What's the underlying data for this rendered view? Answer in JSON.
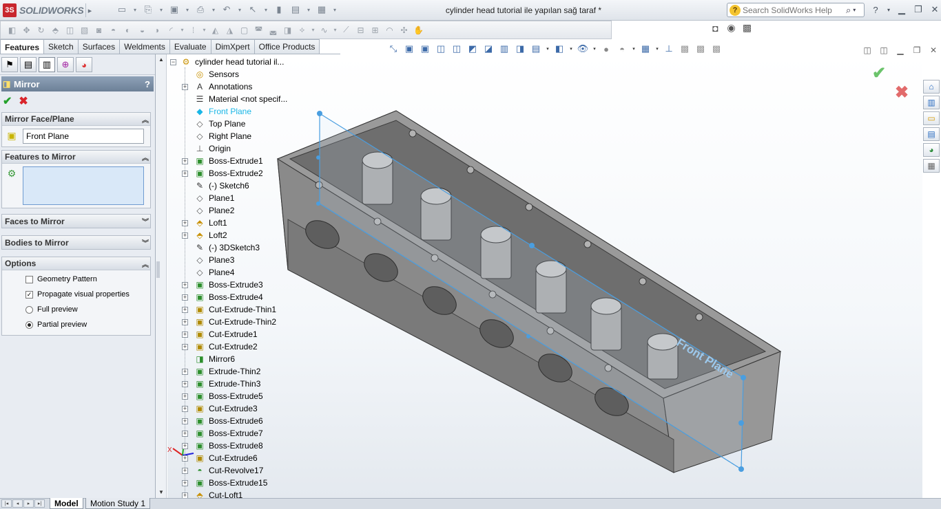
{
  "app": {
    "logo_text": "SOLIDWORKS",
    "document_title": "cylinder head tutorial ile yapılan sağ taraf *",
    "search_placeholder": "Search SolidWorks Help"
  },
  "command_tabs": [
    {
      "label": "Features",
      "active": true
    },
    {
      "label": "Sketch",
      "active": false
    },
    {
      "label": "Surfaces",
      "active": false
    },
    {
      "label": "Weldments",
      "active": false
    },
    {
      "label": "Evaluate",
      "active": false
    },
    {
      "label": "DimXpert",
      "active": false
    },
    {
      "label": "Office Products",
      "active": false
    }
  ],
  "property_manager": {
    "title": "Mirror",
    "help_label": "?",
    "ok_icon": "check-icon",
    "cancel_icon": "x-icon",
    "mirror_face_plane": {
      "heading": "Mirror Face/Plane",
      "value": "Front Plane"
    },
    "features_to_mirror": {
      "heading": "Features to Mirror"
    },
    "faces_to_mirror": {
      "heading": "Faces to Mirror"
    },
    "bodies_to_mirror": {
      "heading": "Bodies to Mirror"
    },
    "options": {
      "heading": "Options",
      "geometry_pattern": {
        "label": "Geometry Pattern",
        "checked": false
      },
      "propagate_visual": {
        "label": "Propagate visual properties",
        "checked": true
      },
      "full_preview": {
        "label": "Full preview",
        "selected": false
      },
      "partial_preview": {
        "label": "Partial preview",
        "selected": true
      }
    }
  },
  "feature_tree": {
    "root": "cylinder head tutorial il...",
    "items": [
      {
        "label": "Sensors",
        "icon": "sensor-icon",
        "expandable": false
      },
      {
        "label": "Annotations",
        "icon": "annotation-icon",
        "expandable": true
      },
      {
        "label": "Material <not specif...",
        "icon": "material-icon",
        "expandable": false
      },
      {
        "label": "Front Plane",
        "icon": "plane-icon",
        "expandable": false,
        "highlight": true
      },
      {
        "label": "Top Plane",
        "icon": "plane-icon",
        "expandable": false
      },
      {
        "label": "Right Plane",
        "icon": "plane-icon",
        "expandable": false
      },
      {
        "label": "Origin",
        "icon": "origin-icon",
        "expandable": false
      },
      {
        "label": "Boss-Extrude1",
        "icon": "extrude-icon",
        "expandable": true
      },
      {
        "label": "Boss-Extrude2",
        "icon": "extrude-icon",
        "expandable": true
      },
      {
        "label": "(-) Sketch6",
        "icon": "sketch-icon",
        "expandable": false
      },
      {
        "label": "Plane1",
        "icon": "plane-icon",
        "expandable": false
      },
      {
        "label": "Plane2",
        "icon": "plane-icon",
        "expandable": false
      },
      {
        "label": "Loft1",
        "icon": "loft-icon",
        "expandable": true
      },
      {
        "label": "Loft2",
        "icon": "loft-icon",
        "expandable": true
      },
      {
        "label": "(-) 3DSketch3",
        "icon": "3dsketch-icon",
        "expandable": false
      },
      {
        "label": "Plane3",
        "icon": "plane-icon",
        "expandable": false
      },
      {
        "label": "Plane4",
        "icon": "plane-icon",
        "expandable": false
      },
      {
        "label": "Boss-Extrude3",
        "icon": "extrude-icon",
        "expandable": true
      },
      {
        "label": "Boss-Extrude4",
        "icon": "extrude-icon",
        "expandable": true
      },
      {
        "label": "Cut-Extrude-Thin1",
        "icon": "cut-icon",
        "expandable": true
      },
      {
        "label": "Cut-Extrude-Thin2",
        "icon": "cut-icon",
        "expandable": true
      },
      {
        "label": "Cut-Extrude1",
        "icon": "cut-icon",
        "expandable": true
      },
      {
        "label": "Cut-Extrude2",
        "icon": "cut-icon",
        "expandable": true
      },
      {
        "label": "Mirror6",
        "icon": "mirror-icon",
        "expandable": false
      },
      {
        "label": "Extrude-Thin2",
        "icon": "extrude-icon",
        "expandable": true
      },
      {
        "label": "Extrude-Thin3",
        "icon": "extrude-icon",
        "expandable": true
      },
      {
        "label": "Boss-Extrude5",
        "icon": "extrude-icon",
        "expandable": true
      },
      {
        "label": "Cut-Extrude3",
        "icon": "cut-icon",
        "expandable": true
      },
      {
        "label": "Boss-Extrude6",
        "icon": "extrude-icon",
        "expandable": true
      },
      {
        "label": "Boss-Extrude7",
        "icon": "extrude-icon",
        "expandable": true
      },
      {
        "label": "Boss-Extrude8",
        "icon": "extrude-icon",
        "expandable": true
      },
      {
        "label": "Cut-Extrude6",
        "icon": "cut-icon",
        "expandable": true
      },
      {
        "label": "Cut-Revolve17",
        "icon": "revolve-icon",
        "expandable": true
      },
      {
        "label": "Boss-Extrude15",
        "icon": "extrude-icon",
        "expandable": true
      },
      {
        "label": "Cut-Loft1",
        "icon": "loft-icon",
        "expandable": true
      }
    ]
  },
  "viewport": {
    "plane_label": "Front Plane",
    "triad_x": "X"
  },
  "bottom_tabs": [
    {
      "label": "Model",
      "active": true
    },
    {
      "label": "Motion Study 1",
      "active": false
    }
  ],
  "colors": {
    "accent": "#19b6e6",
    "ok_green": "#23a12a",
    "cancel_red": "#d9252b",
    "model_gray": "#8a8a8a"
  }
}
